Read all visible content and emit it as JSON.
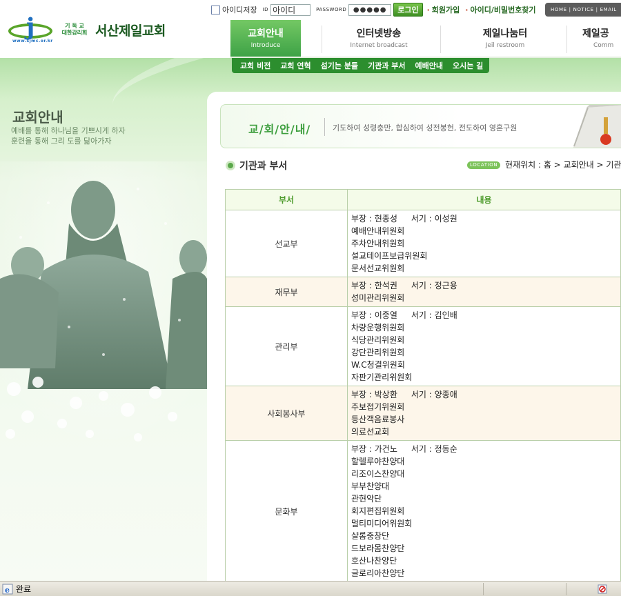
{
  "site": {
    "logo_url": "www.sjmc.or.kr",
    "logo_sub_line1": "기 독 교",
    "logo_sub_line2": "대한감리회",
    "name": "서산제일교회"
  },
  "login": {
    "save_id_label": "아이디저장",
    "id_label": "ID",
    "id_value": "아이디",
    "password_label": "PASSWORD",
    "password_value": "●●●●●",
    "login_button": "로그인",
    "join_link": "회원가입",
    "find_link": "아이디/비밀번호찾기"
  },
  "util_nav": [
    "HOME",
    "NOTICE",
    "EMAIL"
  ],
  "main_nav": [
    {
      "ko": "교회안내",
      "en": "Introduce",
      "active": true
    },
    {
      "ko": "인터넷방송",
      "en": "Internet broadcast",
      "active": false
    },
    {
      "ko": "제일나눔터",
      "en": "Jeil restroom",
      "active": false
    },
    {
      "ko": "제일공",
      "en": "Comm",
      "active": false
    }
  ],
  "sub_nav": [
    "교회 비전",
    "교회 연혁",
    "섬기는 분들",
    "기관과 부서",
    "예배안내",
    "오시는 길"
  ],
  "left": {
    "title": "교회안내",
    "slogan_line1": "예배를 통해 하나님을 기쁘시게 하자",
    "slogan_line2": "훈련을 통해 그리   도를 닮아가자"
  },
  "banner": {
    "title": "교/회/안/내/",
    "motto": "기도하여 성령충만, 합심하여 성전봉헌, 전도하여 영혼구원"
  },
  "page": {
    "title": "기관과 부서",
    "location_label": "LOCATION",
    "breadcrumb": "현재위치 : 홈 > 교회안내 > 기관"
  },
  "table": {
    "headers": [
      "부서",
      "내용"
    ],
    "rows": [
      {
        "dept": "선교부",
        "head": "부장 : 현종성",
        "secretary": "서기 : 이성원",
        "items": [
          "예배안내위원회",
          "주차안내위원회",
          "설교테이프보급위원회",
          "문서선교위원회"
        ]
      },
      {
        "dept": "재무부",
        "head": "부장 : 한석권",
        "secretary": "서기 : 정근용",
        "items": [
          "성미관리위원회"
        ]
      },
      {
        "dept": "관리부",
        "head": "부장 : 이중열",
        "secretary": "서기 : 김인배",
        "items": [
          "차량운행위원회",
          "식당관리위원회",
          "강단관리위원회",
          "W.C청결위원회",
          "자판기관리위원회"
        ]
      },
      {
        "dept": "사회봉사부",
        "head": "부장 : 박상환",
        "secretary": "서기 : 양종애",
        "items": [
          "주보접기위원회",
          "등산객음료봉사",
          "의료선교회"
        ]
      },
      {
        "dept": "문화부",
        "head": "부장 : 가건노",
        "secretary": "서기 : 정동순",
        "items": [
          "할렐루야찬양대",
          "리조이스찬양대",
          "부부찬양대",
          "관현악단",
          "회지편집위원회",
          "멀티미디어위원회",
          "샬롬중창단",
          "드보라몸찬양단",
          "호산나찬양단",
          "글로리아찬양단"
        ]
      }
    ]
  },
  "status_bar": {
    "text": "완료"
  },
  "colors": {
    "brand_green": "#3da246",
    "subnav_green": "#2c8e2e",
    "table_header_text": "#4b9a2a",
    "alt_row": "#fdf6ea"
  }
}
